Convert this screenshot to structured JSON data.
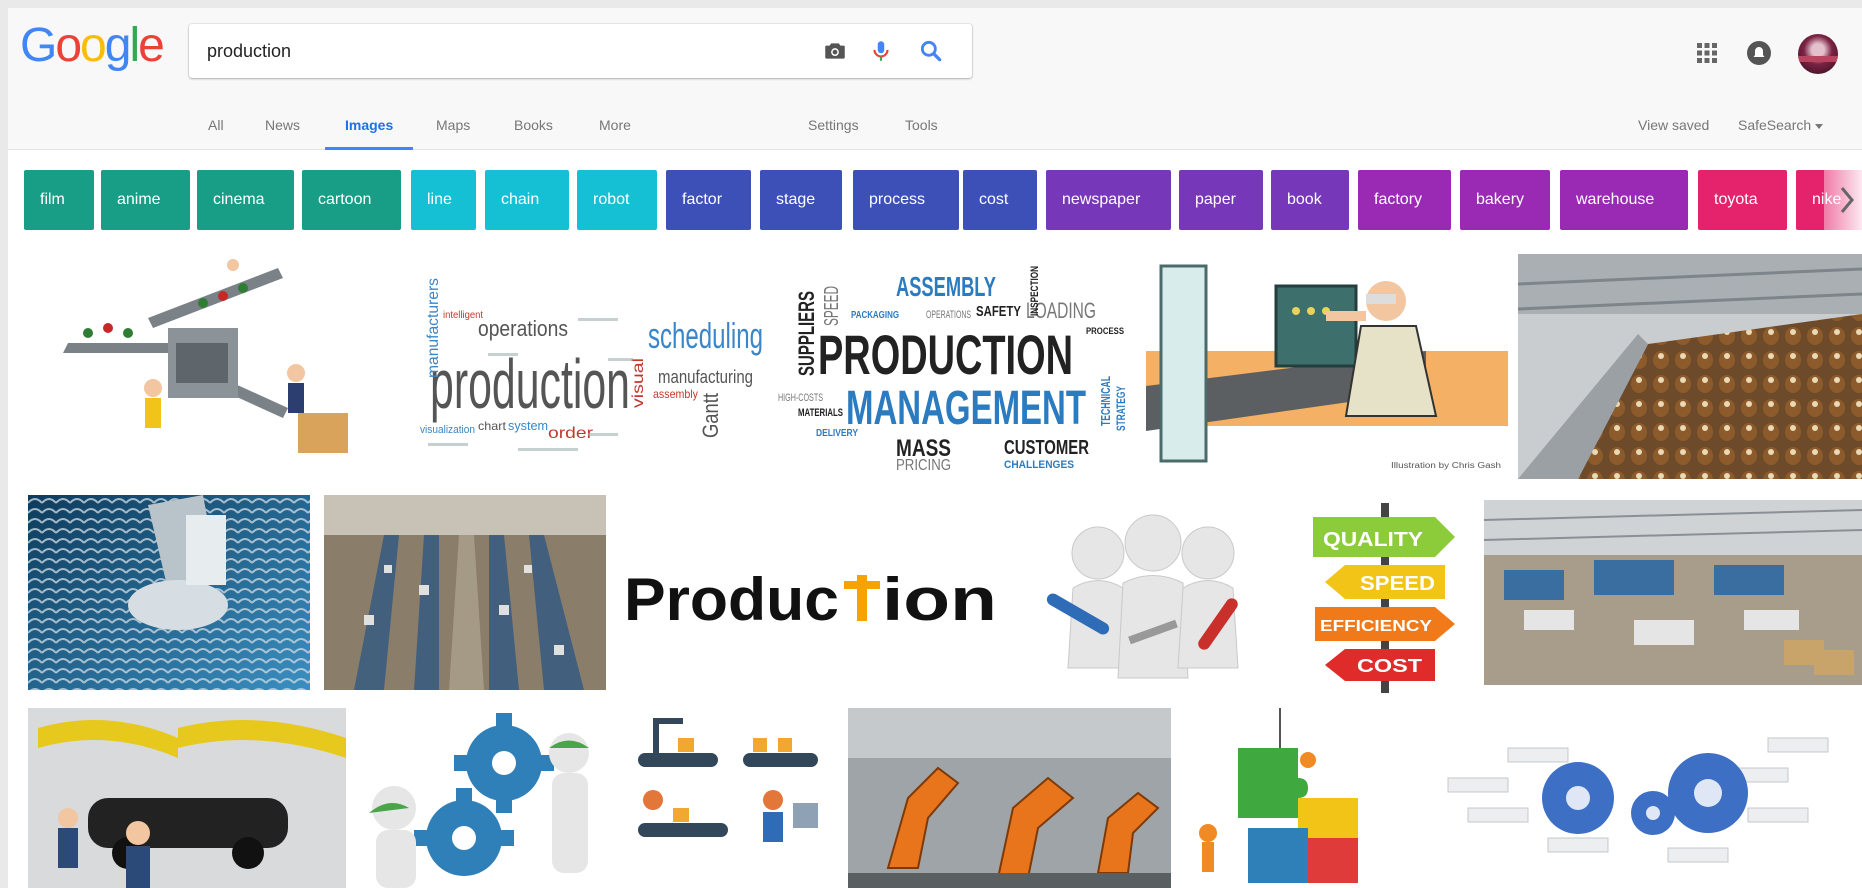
{
  "logo": {
    "letters": [
      "G",
      "o",
      "o",
      "g",
      "l",
      "e"
    ],
    "colors": [
      "#4285f4",
      "#ea4335",
      "#fbbc05",
      "#4285f4",
      "#34a853",
      "#ea4335"
    ]
  },
  "search": {
    "query": "production"
  },
  "icons": {
    "camera": "camera-icon",
    "mic": "mic-icon",
    "search": "search-icon",
    "apps": "apps-grid-icon",
    "notifications": "notifications-icon"
  },
  "nav": {
    "all": "All",
    "news": "News",
    "images": "Images",
    "maps": "Maps",
    "books": "Books",
    "more": "More",
    "settings": "Settings",
    "tools": "Tools",
    "view_saved": "View saved",
    "safesearch": "SafeSearch"
  },
  "chips": [
    {
      "label": "film",
      "color": "#189e86"
    },
    {
      "label": "anime",
      "color": "#189e86"
    },
    {
      "label": "cinema",
      "color": "#189e86"
    },
    {
      "label": "cartoon",
      "color": "#189e86"
    },
    {
      "label": "line",
      "color": "#16c0d4"
    },
    {
      "label": "chain",
      "color": "#16c0d4"
    },
    {
      "label": "robot",
      "color": "#16c0d4"
    },
    {
      "label": "factor",
      "color": "#3d50b8"
    },
    {
      "label": "stage",
      "color": "#3d50b8"
    },
    {
      "label": "process",
      "color": "#3d50b8"
    },
    {
      "label": "cost",
      "color": "#3d50b8"
    },
    {
      "label": "newspaper",
      "color": "#7637b8"
    },
    {
      "label": "paper",
      "color": "#7637b8"
    },
    {
      "label": "book",
      "color": "#7637b8"
    },
    {
      "label": "factory",
      "color": "#9a2ab4"
    },
    {
      "label": "bakery",
      "color": "#9a2ab4"
    },
    {
      "label": "warehouse",
      "color": "#9a2ab4"
    },
    {
      "label": "toyota",
      "color": "#e5226c"
    },
    {
      "label": "nike",
      "color": "#e5226c"
    }
  ],
  "images": {
    "wordcloud1": {
      "main": "production",
      "words": [
        "scheduling",
        "operations",
        "manufacturers",
        "manufacturing",
        "visual",
        "order",
        "system",
        "chart",
        "Gantt",
        "visualization",
        "assembly",
        "intelligent"
      ]
    },
    "wordcloud2": {
      "words": [
        "ASSEMBLY",
        "SAFETY",
        "LOADING",
        "PRODUCTION",
        "SUPPLIERS",
        "MANAGEMENT",
        "MASS",
        "CUSTOMER",
        "PRICING",
        "MATERIALS",
        "CHALLENGES",
        "SPEED",
        "OPERATIONS",
        "PACKAGING",
        "HIGH-COSTS",
        "DELIVERY",
        "TECHNICAL",
        "STRATEGY",
        "PROCESS",
        "INSPECTION"
      ]
    },
    "illustration_credit": "Illustration by Chris Gash",
    "logo_text": {
      "before": "Produc",
      "after": "ion"
    },
    "signpost": [
      "QUALITY",
      "SPEED",
      "EFFICIENCY",
      "COST"
    ]
  }
}
